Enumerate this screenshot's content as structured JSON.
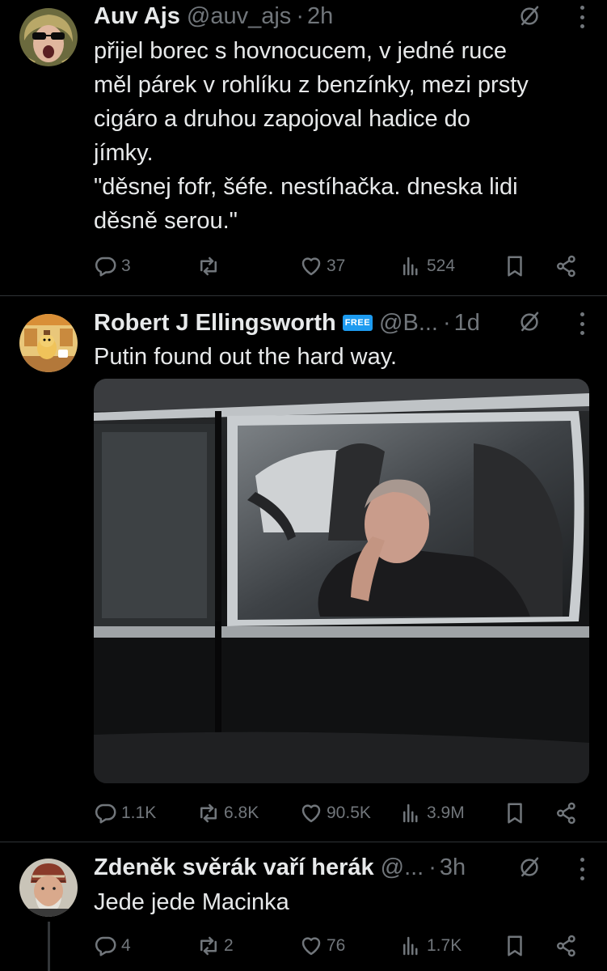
{
  "tweets": [
    {
      "name": "Auv Ajs",
      "handle": "@auv_ajs",
      "dot": "·",
      "time": "2h",
      "lines": [
        "přijel borec s hovnocucem, v jedné ruce",
        "měl párek v rohlíku z benzínky, mezi prsty",
        "cigáro a druhou zapojoval hadice do",
        "jímky.",
        "\"děsnej fofr, šéfe. nestíhačka. dneska lidi",
        "děsně serou.\""
      ],
      "replies": "3",
      "reposts": "",
      "likes": "37",
      "views": "524"
    },
    {
      "name": "Robert J Ellingsworth",
      "badge": "FREE",
      "handle": "@B...",
      "dot": "·",
      "time": "1d",
      "lines": [
        "Putin found out the hard way."
      ],
      "replies": "1.1K",
      "reposts": "6.8K",
      "likes": "90.5K",
      "views": "3.9M"
    },
    {
      "name": "Zdeněk svěrák vaří herák",
      "handle": "@...",
      "dot": "·",
      "time": "3h",
      "lines": [
        "Jede jede Macinka"
      ],
      "replies": "4",
      "reposts": "2",
      "likes": "76",
      "views": "1.7K"
    }
  ],
  "colors": {
    "background": "#000000",
    "text": "#e7e9ea",
    "muted": "#71767b",
    "divider": "#2f3336",
    "badge": "#1d9bf0"
  },
  "icons": [
    "grok-icon",
    "more-icon",
    "reply-icon",
    "repost-icon",
    "like-icon",
    "views-icon",
    "bookmark-icon",
    "share-icon"
  ]
}
